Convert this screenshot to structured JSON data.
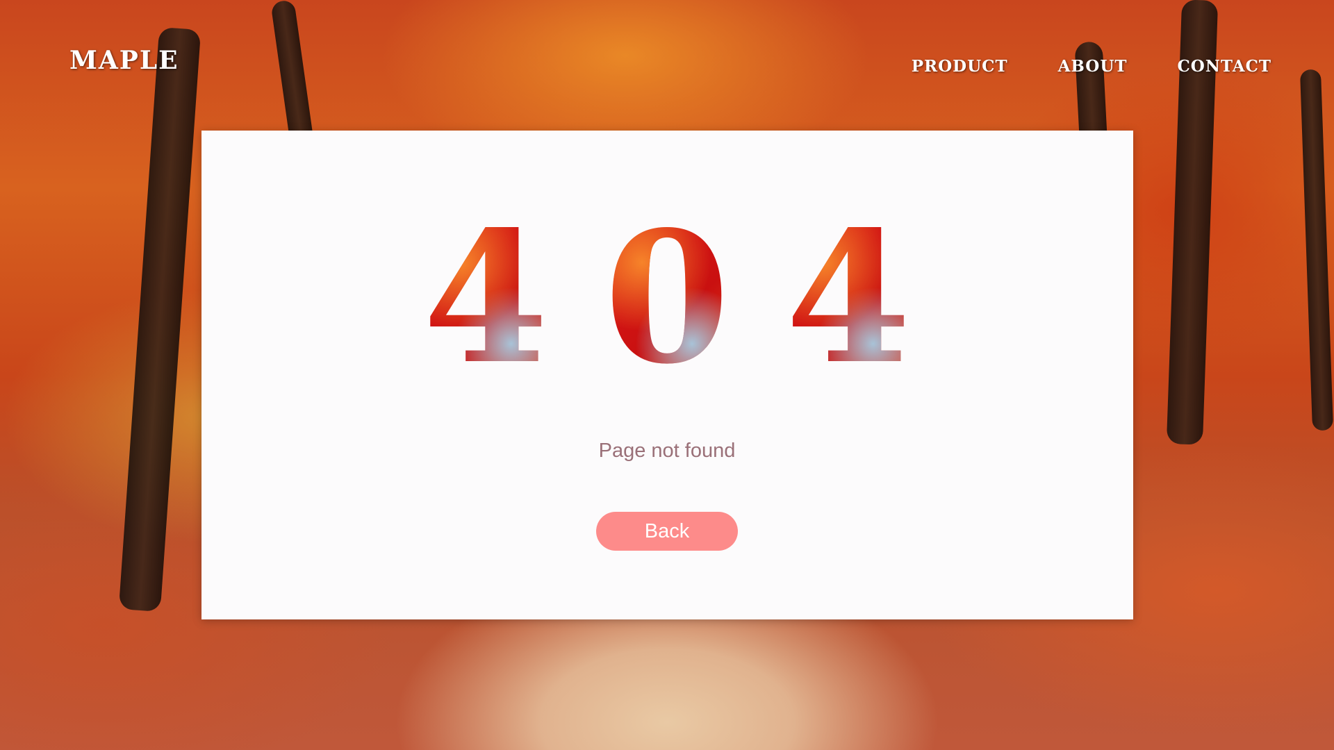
{
  "brand": {
    "name": "MAPLE"
  },
  "nav": {
    "items": [
      {
        "label": "PRODUCT"
      },
      {
        "label": "ABOUT"
      },
      {
        "label": "CONTACT"
      }
    ]
  },
  "error": {
    "digits": [
      "4",
      "0",
      "4"
    ],
    "message": "Page not found",
    "back_label": "Back"
  },
  "colors": {
    "card_background": "#fcfbfc",
    "message_text": "#9a7078",
    "button_background": "#fd8b8a",
    "nav_text": "#ffffff"
  }
}
